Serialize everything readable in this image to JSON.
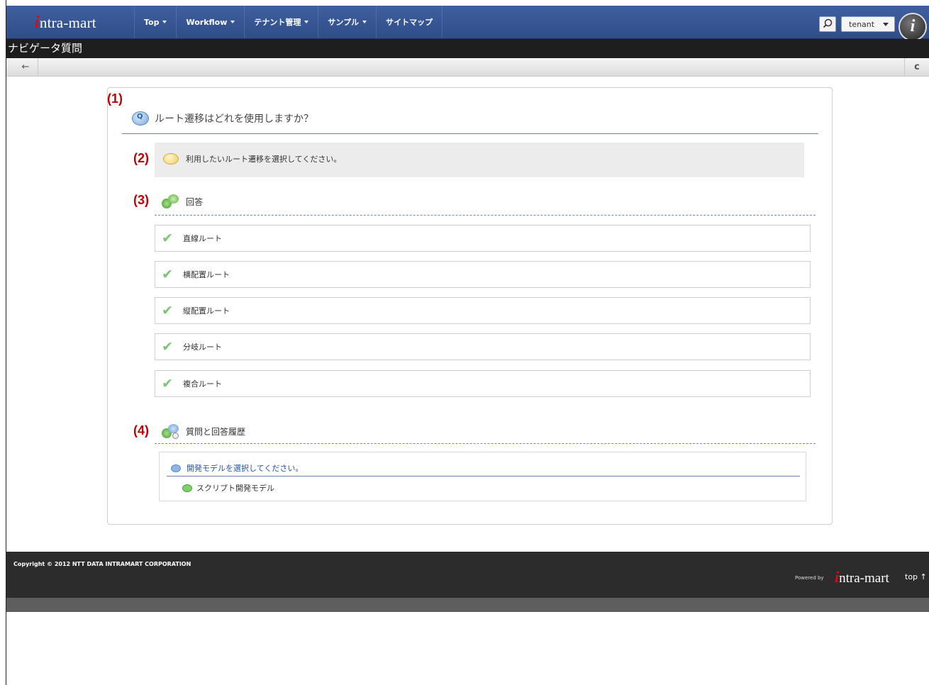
{
  "header": {
    "logo_text": "ntra-mart",
    "menu": [
      {
        "label": "Top",
        "has_dropdown": true
      },
      {
        "label": "Workflow",
        "has_dropdown": true
      },
      {
        "label": "テナント管理",
        "has_dropdown": true
      },
      {
        "label": "サンプル",
        "has_dropdown": true
      },
      {
        "label": "サイトマップ",
        "has_dropdown": false
      }
    ],
    "tenant_select": "tenant",
    "avatar_glyph": "i"
  },
  "page_title": "ナビゲータ質問",
  "toolbar": {
    "back_icon": "←",
    "reload_icon": "c"
  },
  "question": {
    "marker": "(1)",
    "text": "ルート遷移はどれを使用しますか？"
  },
  "hint": {
    "marker": "(2)",
    "text": "利用したいルート遷移を選択してください。"
  },
  "answers_section": {
    "marker": "(3)",
    "title": "回答",
    "items": [
      "直線ルート",
      "横配置ルート",
      "縦配置ルート",
      "分岐ルート",
      "複合ルート"
    ]
  },
  "history_section": {
    "marker": "(4)",
    "title": "質問と回答履歴",
    "question": "開発モデルを選択してください。",
    "answer": "スクリプト開発モデル"
  },
  "footer": {
    "copyright": "Copyright © 2012 NTT DATA INTRAMART CORPORATION",
    "powered_by": "Powered by",
    "logo_text": "ntra-mart",
    "top_link": "top ↑"
  }
}
